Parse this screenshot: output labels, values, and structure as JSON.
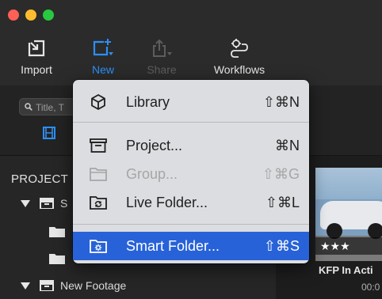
{
  "window": {
    "toolbar": {
      "import_label": "Import",
      "new_label": "New",
      "share_label": "Share",
      "workflows_label": "Workflows"
    },
    "search": {
      "placeholder": "Title, T"
    },
    "sidebar": {
      "projects_heading": "PROJECT",
      "rows": [
        {
          "label": "S"
        },
        {
          "label": "New Footage"
        }
      ]
    },
    "content": {
      "rating": "★★★",
      "title": "KFP In Acti",
      "time": "00:0"
    }
  },
  "menu": {
    "items": [
      {
        "label": "Library",
        "shortcut": "⇧⌘N",
        "icon": "cube-icon",
        "state": "enabled"
      },
      {
        "label": "Project...",
        "shortcut": "⌘N",
        "icon": "tray-icon",
        "state": "enabled"
      },
      {
        "label": "Group...",
        "shortcut": "⇧⌘G",
        "icon": "folder-icon",
        "state": "disabled"
      },
      {
        "label": "Live Folder...",
        "shortcut": "⇧⌘L",
        "icon": "live-folder-icon",
        "state": "enabled"
      },
      {
        "label": "Smart Folder...",
        "shortcut": "⇧⌘S",
        "icon": "smart-folder-icon",
        "state": "selected"
      }
    ]
  },
  "colors": {
    "accent": "#2c8ff7",
    "selection": "#2762d8",
    "menu_bg": "#dcdde0",
    "window_bg": "#262626"
  }
}
